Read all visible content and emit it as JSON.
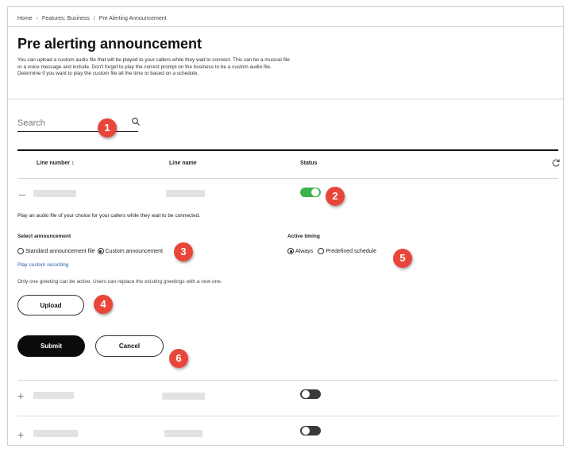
{
  "breadcrumb": {
    "items": [
      "Home",
      "Features: Business",
      "Pre Alerting Announcement"
    ],
    "separator": "/"
  },
  "page": {
    "title": "Pre alerting announcement",
    "description": "You can upload a custom audio file that will be played to your callers while they wait to connect. This can be a musical file or a voice message and include. Don't forget to play the correct prompt on the business to be a custom audio file. Determine if you want to play the custom file all the time or based on a schedule."
  },
  "search": {
    "placeholder": "Search"
  },
  "table": {
    "columns": [
      "Line number ↕",
      "Line name",
      "Status"
    ],
    "refresh_icon": "refresh-icon",
    "rows": [
      {
        "expander": "–",
        "status": "on"
      },
      {
        "expander": "+",
        "status": "off"
      },
      {
        "expander": "+",
        "status": "off"
      }
    ]
  },
  "expanded": {
    "play_text": "Play an audio file of your choice for your callers while they wait to be connected.",
    "select_label": "Select announcement",
    "options": [
      "Standard announcement file",
      "Custom announcement"
    ],
    "selected_option": "Custom announcement",
    "play_link": "Play custom recording",
    "active_label": "Active timing",
    "timing_options": [
      "Always",
      "Predefined schedule"
    ],
    "selected_timing": "Always",
    "note": "Only one greeting can be active. Users can replace the existing greetings with a new one.",
    "upload_label": "Upload",
    "submit_label": "Submit",
    "cancel_label": "Cancel"
  },
  "callouts": [
    "1",
    "2",
    "3",
    "4",
    "5",
    "6"
  ],
  "colors": {
    "toggle_on": "#3cb44b",
    "toggle_off": "#3a3a3a",
    "callout": "#e8463a",
    "primary_button": "#0b0b0b"
  }
}
